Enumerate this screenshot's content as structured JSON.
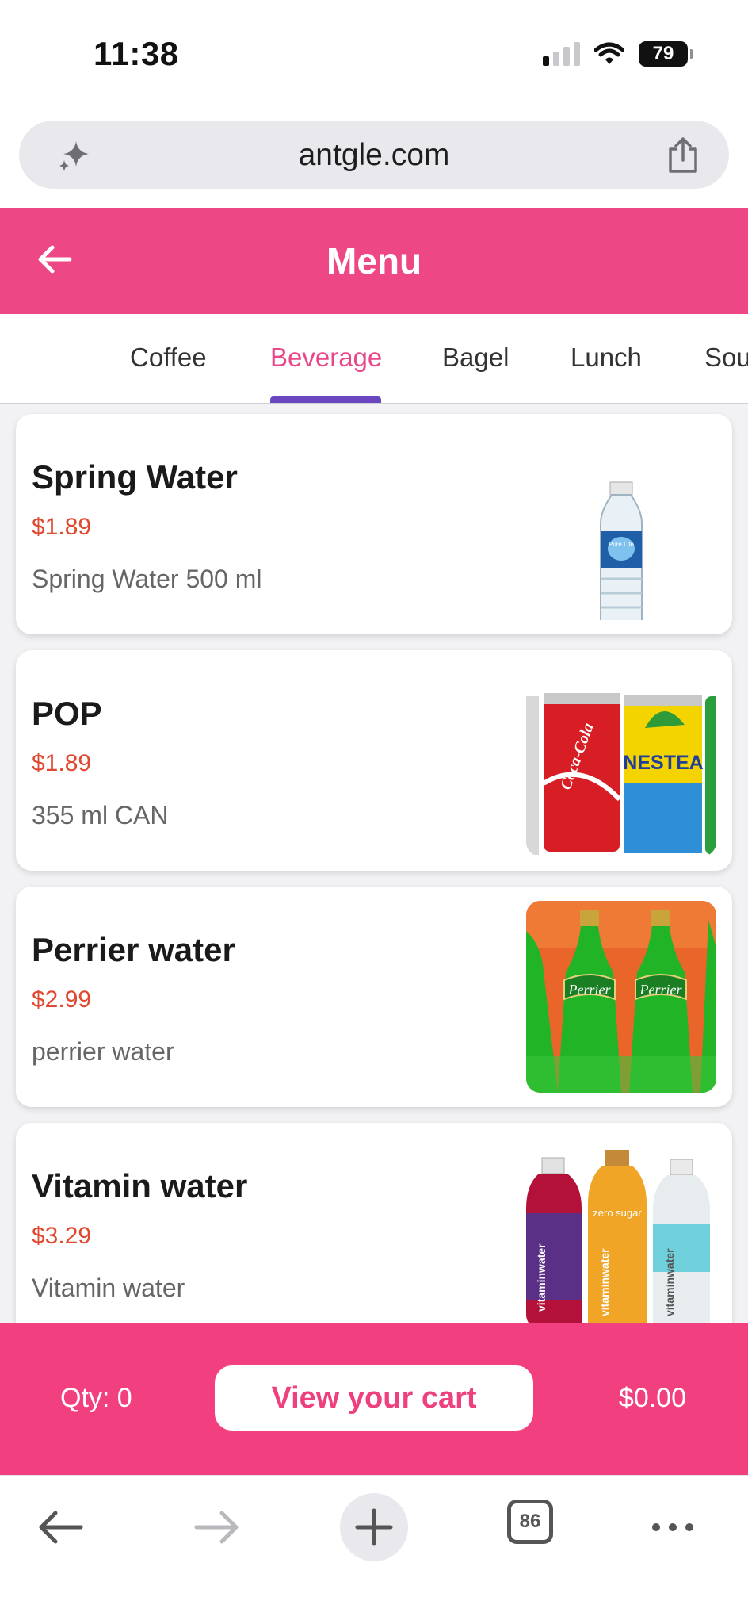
{
  "status_bar": {
    "time": "11:38",
    "battery": "79"
  },
  "browser": {
    "url": "antgle.com",
    "tabs_count": "86"
  },
  "header": {
    "title": "Menu"
  },
  "tabs": [
    {
      "label": "Coffee",
      "active": false
    },
    {
      "label": "Beverage",
      "active": true
    },
    {
      "label": "Bagel",
      "active": false
    },
    {
      "label": "Lunch",
      "active": false
    },
    {
      "label": "Sou",
      "active": false
    }
  ],
  "items": [
    {
      "name": "Spring Water",
      "price": "$1.89",
      "description": "Spring Water 500 ml",
      "image": "water-bottle"
    },
    {
      "name": "POP",
      "price": "$1.89",
      "description": "355 ml CAN",
      "image": "soda-cans"
    },
    {
      "name": "Perrier water",
      "price": "$2.99",
      "description": "perrier water",
      "image": "perrier-bottles"
    },
    {
      "name": "Vitamin water",
      "price": "$3.29",
      "description": "Vitamin water",
      "image": "vitamin-water-bottles"
    }
  ],
  "image_text": {
    "pure_life": "Pure Life",
    "coca_cola": "Coca-Cola",
    "nestea": "NESTEA",
    "perrier": "Perrier",
    "vitamin_water": "vitaminwater",
    "zero_sugar": "zero sugar"
  },
  "cart": {
    "qty": "Qty: 0",
    "button": "View your cart",
    "total": "$0.00"
  },
  "colors": {
    "brand_pink": "#ee4785",
    "price_red": "#e04830",
    "tab_indicator": "#6b46c1"
  }
}
